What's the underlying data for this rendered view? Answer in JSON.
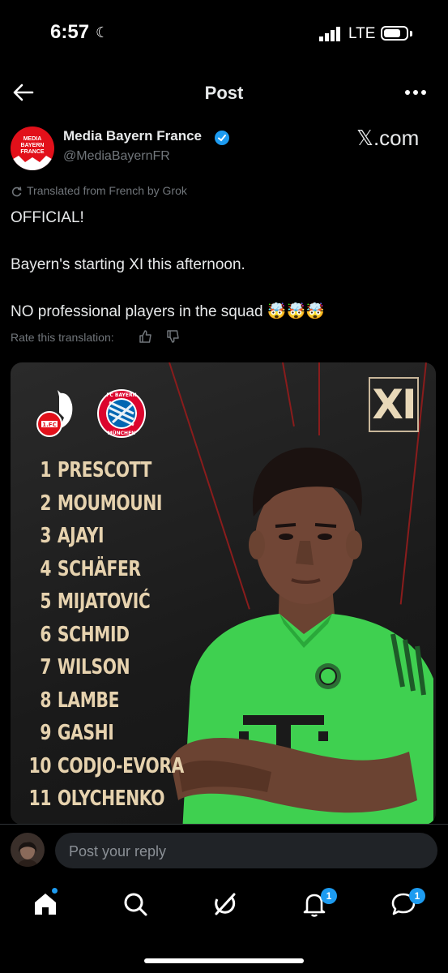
{
  "status_bar": {
    "time": "6:57",
    "network": "LTE"
  },
  "header": {
    "title": "Post"
  },
  "author": {
    "name": "Media Bayern France",
    "handle": "@MediaBayernFR",
    "avatar_text": "MEDIA\nBAYERN\nFRANCE",
    "source": "𝕏.com"
  },
  "translation_note": "Translated from French by Grok",
  "post_text": "OFFICIAL!\n\nBayern's starting XI this afternoon.\n\nNO professional players in the squad 🤯🤯🤯",
  "rate_translation": "Rate this translation:",
  "media": {
    "badge": "XI",
    "lineup": [
      {
        "number": "1",
        "name": "PRESCOTT"
      },
      {
        "number": "2",
        "name": "MOUMOUNI"
      },
      {
        "number": "3",
        "name": "AJAYI"
      },
      {
        "number": "4",
        "name": "SCHÄFER"
      },
      {
        "number": "5",
        "name": "MIJATOVIĆ"
      },
      {
        "number": "6",
        "name": "SCHMID"
      },
      {
        "number": "7",
        "name": "WILSON"
      },
      {
        "number": "8",
        "name": "LAMBE"
      },
      {
        "number": "9",
        "name": "GASHI"
      },
      {
        "number": "10",
        "name": "CODJO-EVORA"
      },
      {
        "number": "11",
        "name": "OLYCHENKO"
      }
    ]
  },
  "reply": {
    "placeholder": "Post your reply"
  },
  "nav": {
    "notifications_badge": "1",
    "messages_badge": "1"
  },
  "colors": {
    "accent": "#1d9bf0",
    "jersey": "#4fdc5c",
    "lineup_text": "#e6d2ae"
  }
}
